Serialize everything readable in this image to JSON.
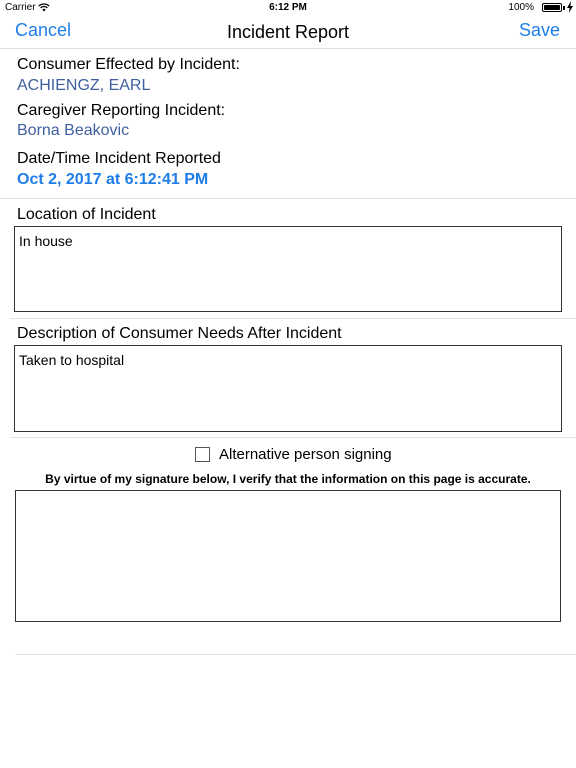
{
  "status_bar": {
    "carrier": "Carrier",
    "time": "6:12 PM",
    "battery": "100%"
  },
  "nav": {
    "cancel_label": "Cancel",
    "title": "Incident Report",
    "save_label": "Save"
  },
  "consumer": {
    "label": "Consumer Effected by Incident:",
    "value": "ACHIENGZ, EARL"
  },
  "caregiver": {
    "label": "Caregiver Reporting Incident:",
    "value": "Borna Beakovic"
  },
  "reported": {
    "label": "Date/Time Incident Reported",
    "value": "Oct 2, 2017 at 6:12:41 PM"
  },
  "location": {
    "label": "Location of Incident",
    "value": "In house"
  },
  "needs": {
    "label": "Description of Consumer Needs After Incident",
    "value": "Taken to hospital"
  },
  "signature": {
    "alternative_label": "Alternative person signing",
    "alternative_checked": false,
    "verify_text": "By virtue of my signature below, I verify that the information on this page is accurate."
  },
  "colors": {
    "accent": "#1e7ee8",
    "value_text": "#3f5fa0"
  }
}
